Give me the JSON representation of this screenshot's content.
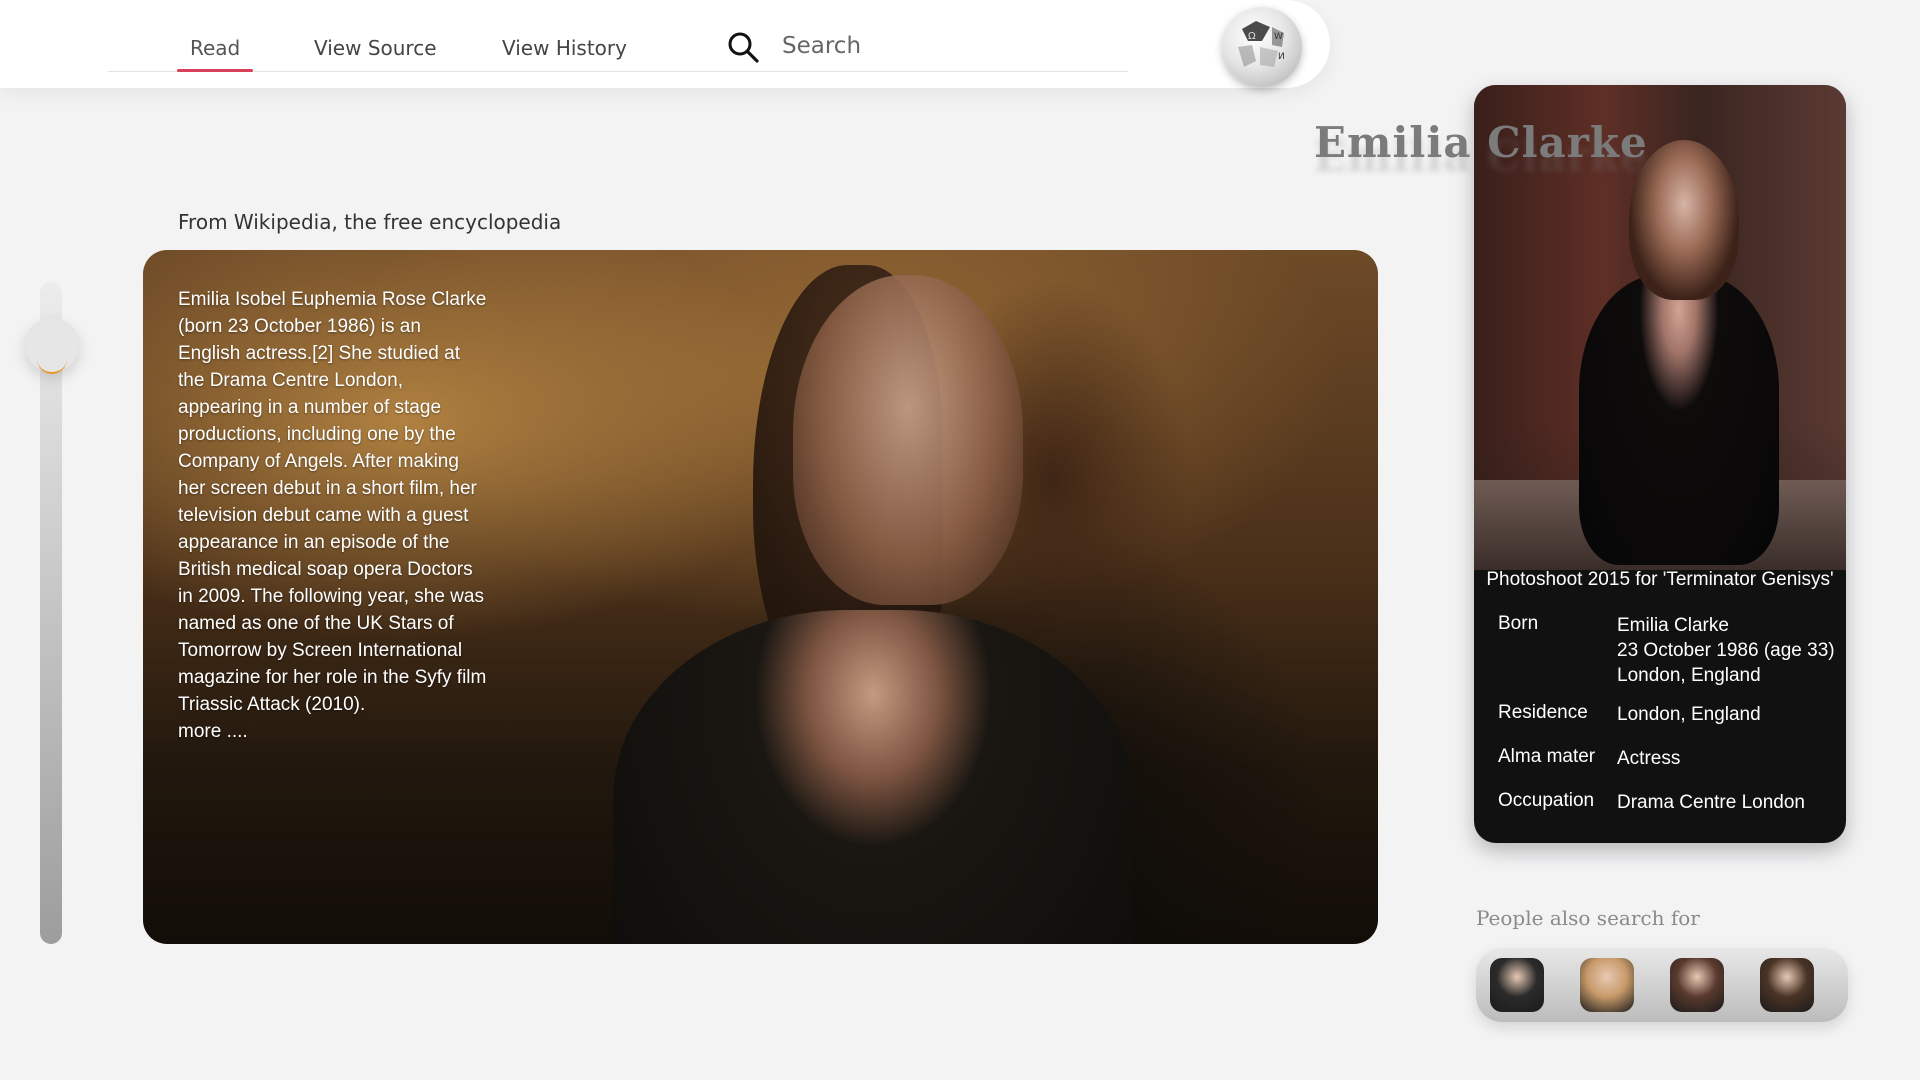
{
  "nav": {
    "tabs": [
      {
        "label": "Read"
      },
      {
        "label": "View Source"
      },
      {
        "label": "View History"
      }
    ],
    "search": {
      "placeholder": "Search",
      "icon": "search-icon"
    },
    "logo": {
      "icon": "wikipedia-globe-icon",
      "glyphs": [
        "Ω",
        "W",
        "И"
      ]
    }
  },
  "article": {
    "source_note": "From Wikipedia, the free encyclopedia",
    "title": "Emilia Clarke",
    "summary": "Emilia Isobel Euphemia Rose Clarke (born 23 October 1986) is an English actress.[2] She studied at the Drama Centre London, appearing in a number of stage productions, including one by the Company of Angels. After making her screen debut in a short film, her television debut came with a guest appearance in an episode of the British medical soap opera Doctors in 2009. The following year, she was named as one of the UK Stars of Tomorrow by Screen International magazine for her role in the Syfy film Triassic Attack (2010).",
    "more_label": "more ...."
  },
  "infobox": {
    "caption": "Photoshoot 2015 for 'Terminator Genisys'",
    "rows": [
      {
        "label": "Born",
        "value": [
          "Emilia  Clarke",
          "23 October 1986 (age 33)",
          "London, England"
        ]
      },
      {
        "label": "Residence",
        "value": [
          "London, England"
        ]
      },
      {
        "label": "Alma mater",
        "value": [
          "Actress"
        ]
      },
      {
        "label": "Occupation",
        "value": [
          "Drama Centre London"
        ]
      }
    ]
  },
  "related": {
    "heading": "People also search for",
    "people": [
      {
        "icon": "person-avatar-1",
        "tone": "#2b2b2b"
      },
      {
        "icon": "person-avatar-2",
        "tone": "#c79a6a"
      },
      {
        "icon": "person-avatar-3",
        "tone": "#5a3a2e"
      },
      {
        "icon": "person-avatar-4",
        "tone": "#4a3426"
      }
    ]
  },
  "colors": {
    "accent_underline": "#d9405a",
    "slider_accent": "#e19a2c"
  }
}
